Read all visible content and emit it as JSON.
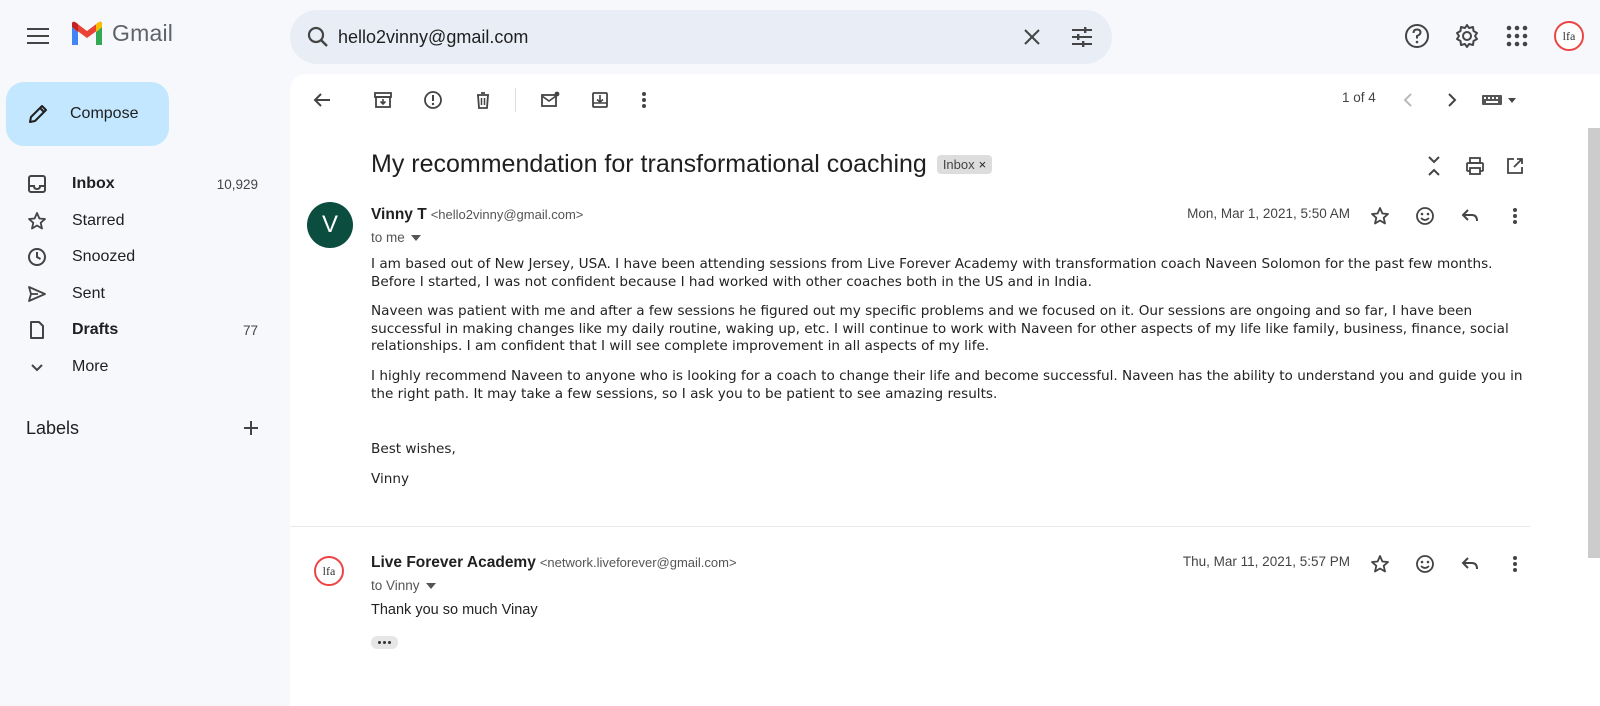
{
  "app": {
    "name": "Gmail"
  },
  "search": {
    "value": "hello2vinny@gmail.com"
  },
  "compose": {
    "label": "Compose"
  },
  "nav": [
    {
      "label": "Inbox",
      "count": "10,929",
      "icon": "inbox-icon"
    },
    {
      "label": "Starred",
      "count": "",
      "icon": "star-icon"
    },
    {
      "label": "Snoozed",
      "count": "",
      "icon": "clock-icon"
    },
    {
      "label": "Sent",
      "count": "",
      "icon": "send-icon"
    },
    {
      "label": "Drafts",
      "count": "77",
      "icon": "draft-icon"
    },
    {
      "label": "More",
      "count": "",
      "icon": "chevron-down-icon"
    }
  ],
  "labels": {
    "title": "Labels"
  },
  "pager": {
    "text": "1 of 4"
  },
  "thread": {
    "subject": "My recommendation for transformational coaching",
    "chip": "Inbox",
    "messages": [
      {
        "avatar": "V",
        "sender_name": "Vinny T",
        "sender_email": "<hello2vinny@gmail.com>",
        "to": "to me",
        "date": "Mon, Mar 1, 2021, 5:50 AM",
        "paragraphs": [
          "I am based out of New Jersey, USA. I have been attending sessions from Live Forever Academy with transformation coach Naveen Solomon for the past few months. Before I started, I was not confident because I had worked with other coaches both in the US and in India.",
          "Naveen was patient with me and after a few sessions he figured out my specific problems and we focused on it. Our sessions are ongoing and so far, I have been successful in making changes like my daily routine, waking up, etc. I will continue to work with Naveen for other aspects of my life like family, business, finance, social relationships. I am confident that I will see complete improvement in all aspects of my life.",
          "I highly recommend Naveen to anyone who is looking for a coach to change their life and become successful. Naveen has the ability to understand you and guide you in the right path. It may take a few sessions, so I ask you to be patient to see amazing results."
        ],
        "signoff": "Best wishes,",
        "signature": "Vinny"
      },
      {
        "avatar": "lfa",
        "sender_name": "Live Forever Academy",
        "sender_email": "<network.liveforever@gmail.com>",
        "to": "to Vinny",
        "date": "Thu, Mar 11, 2021, 5:57 PM",
        "text": "Thank you so much Vinay"
      }
    ]
  },
  "account": {
    "avatar_text": "lfa"
  },
  "colors": {
    "accent": "#c2e7ff",
    "avatar_v": "#0b4d3f",
    "surface": "#f6f8fc"
  }
}
